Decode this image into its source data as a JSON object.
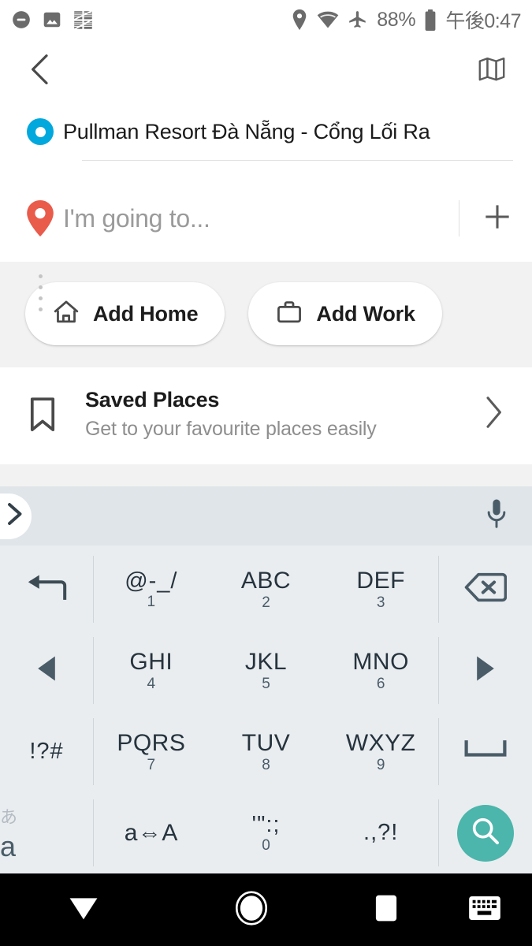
{
  "status_bar": {
    "left_icons": [
      "do-not-disturb-icon",
      "screenshot-image-icon",
      "textured-app-icon"
    ],
    "right_icons": [
      "location-icon",
      "wifi-icon",
      "airplane-mode-icon"
    ],
    "battery_percent": "88%",
    "battery_icon": "battery-icon",
    "clock": "午後0:47"
  },
  "action_bar": {
    "back_icon": "back-chevron-icon",
    "map_icon": "folded-map-icon"
  },
  "route": {
    "origin": {
      "marker": "origin-circle-marker",
      "value": "Pullman Resort Đà Nẵng - Cổng Lối Ra",
      "marker_color": "#00a8dd"
    },
    "destination": {
      "marker": "destination-pin-marker",
      "placeholder": "I'm going to...",
      "value": "",
      "marker_color": "#e95b4b"
    },
    "add_waypoint_icon": "plus-icon"
  },
  "shortcuts": [
    {
      "label": "Add Home",
      "icon": "home-icon"
    },
    {
      "label": "Add Work",
      "icon": "briefcase-icon"
    }
  ],
  "saved_places": {
    "icon": "bookmark-icon",
    "title": "Saved Places",
    "subtitle": "Get to your favourite places easily",
    "chevron": "chevron-right-icon"
  },
  "keyboard": {
    "suggestion_bar": {
      "expand_icon": "chevron-right-icon",
      "mic_icon": "microphone-icon"
    },
    "accent_color": "#4cb5ac",
    "rows": [
      {
        "left": {
          "name": "undo-key",
          "icon": "undo-arrow-icon"
        },
        "keys": [
          {
            "main": "@-_/",
            "sub": "1"
          },
          {
            "main": "ABC",
            "sub": "2"
          },
          {
            "main": "DEF",
            "sub": "3"
          }
        ],
        "right": {
          "name": "backspace-key",
          "icon": "backspace-icon"
        }
      },
      {
        "left": {
          "name": "cursor-left-key",
          "icon": "arrow-left-icon"
        },
        "keys": [
          {
            "main": "GHI",
            "sub": "4"
          },
          {
            "main": "JKL",
            "sub": "5"
          },
          {
            "main": "MNO",
            "sub": "6"
          }
        ],
        "right": {
          "name": "cursor-right-key",
          "icon": "arrow-right-icon"
        }
      },
      {
        "left": {
          "name": "symbols-key",
          "label": "!?#"
        },
        "keys": [
          {
            "main": "PQRS",
            "sub": "7"
          },
          {
            "main": "TUV",
            "sub": "8"
          },
          {
            "main": "WXYZ",
            "sub": "9"
          }
        ],
        "right": {
          "name": "space-key",
          "icon": "space-bar-icon"
        }
      },
      {
        "left": {
          "name": "language-key",
          "label_small": "あ",
          "label_big": "a"
        },
        "keys": [
          {
            "main": "a⇔A",
            "sub": ""
          },
          {
            "main": "'\":;",
            "sub": "0"
          },
          {
            "main": ".,?!",
            "sub": ""
          }
        ],
        "right": {
          "name": "search-key",
          "icon": "search-icon"
        }
      }
    ]
  },
  "nav_bar": {
    "back_icon": "hide-keyboard-down-icon",
    "home_icon": "home-circle-icon",
    "recents_icon": "recents-square-icon",
    "keyboard_switch_icon": "keyboard-switcher-icon"
  }
}
